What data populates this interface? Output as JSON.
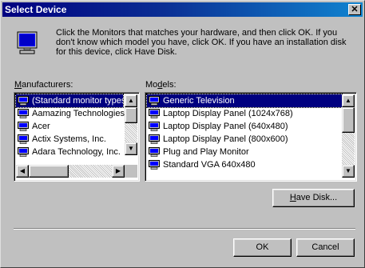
{
  "window": {
    "title": "Select Device",
    "close_glyph": "✕"
  },
  "description": "Click the Monitors that matches your hardware, and then click OK. If you don't know which model you have, click OK. If you have an installation disk for this device, click Have Disk.",
  "manufacturers": {
    "label_accel": "M",
    "label_rest": "anufacturers:",
    "items": [
      {
        "label": "(Standard monitor types",
        "icon": "monitor-icon"
      },
      {
        "label": "Aamazing Technologies",
        "icon": "monitor-icon"
      },
      {
        "label": "Acer",
        "icon": "monitor-icon"
      },
      {
        "label": "Actix Systems, Inc.",
        "icon": "monitor-icon"
      },
      {
        "label": "Adara Technology, Inc.",
        "icon": "monitor-icon"
      }
    ],
    "selected_index": 0
  },
  "models": {
    "label_pre": "Mo",
    "label_accel": "d",
    "label_rest": "els:",
    "items": [
      {
        "label": "Generic Television",
        "icon": "monitor-icon"
      },
      {
        "label": "Laptop Display Panel (1024x768)",
        "icon": "monitor-icon"
      },
      {
        "label": "Laptop Display Panel (640x480)",
        "icon": "monitor-icon"
      },
      {
        "label": "Laptop Display Panel (800x600)",
        "icon": "monitor-icon"
      },
      {
        "label": "Plug and Play Monitor",
        "icon": "monitor-icon"
      },
      {
        "label": "Standard VGA 640x480",
        "icon": "monitor-icon"
      }
    ],
    "selected_index": 0
  },
  "buttons": {
    "have_disk_accel": "H",
    "have_disk_rest": "ave Disk...",
    "ok": "OK",
    "cancel": "Cancel"
  },
  "colors": {
    "selection": "#000080",
    "face": "#c0c0c0",
    "title_start": "#000080",
    "title_end": "#1084d0"
  }
}
